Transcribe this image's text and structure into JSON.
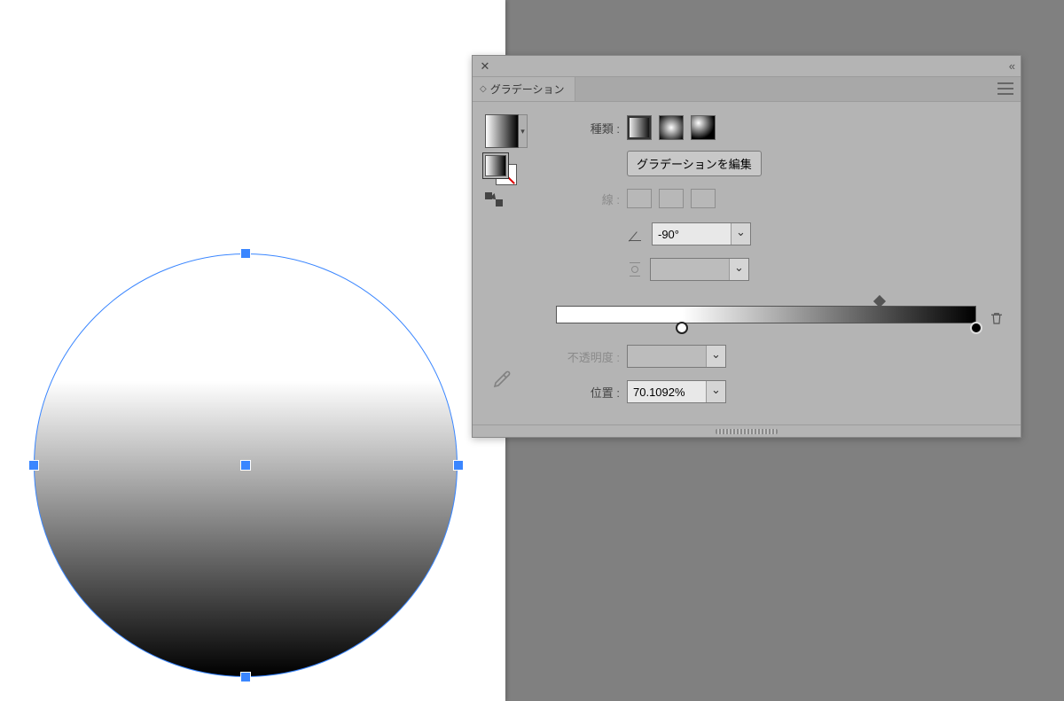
{
  "panel": {
    "tab_title": "グラデーション",
    "type_label": "種類 :",
    "edit_button": "グラデーションを編集",
    "stroke_label": "線 :",
    "angle_value": "-90°",
    "opacity_label": "不透明度 :",
    "location_label": "位置 :",
    "location_value": "70.1092%"
  },
  "gradient": {
    "stops": [
      {
        "pos_pct": 30,
        "color": "#ffffff"
      },
      {
        "pos_pct": 100,
        "color": "#000000"
      }
    ],
    "midpoint_pct": 77
  }
}
